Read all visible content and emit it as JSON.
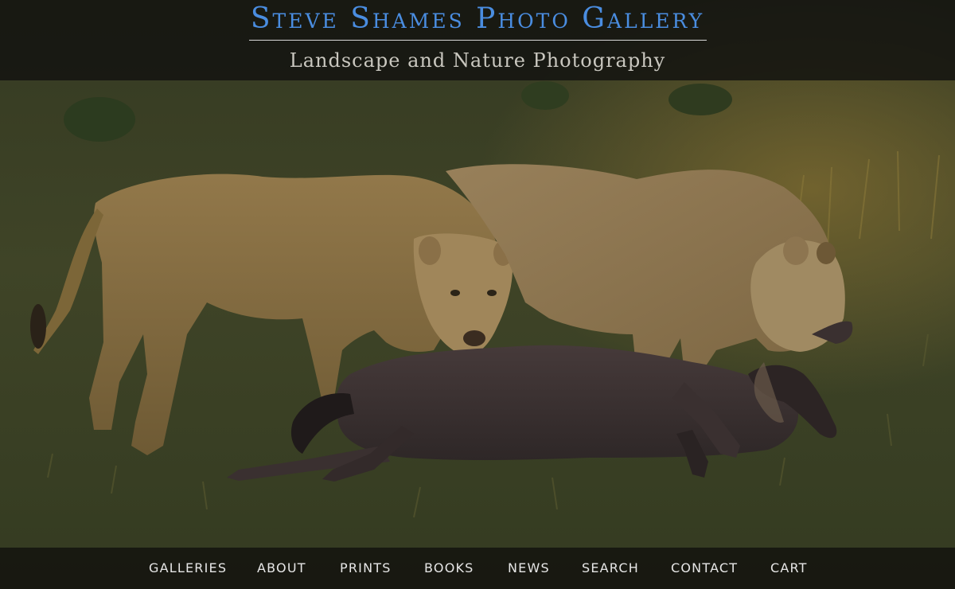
{
  "header": {
    "title": "Steve Shames Photo Gallery",
    "tagline": "Landscape and Nature Photography"
  },
  "nav": {
    "items": [
      {
        "label": "GALLERIES"
      },
      {
        "label": "ABOUT"
      },
      {
        "label": "PRINTS"
      },
      {
        "label": "BOOKS"
      },
      {
        "label": "NEWS"
      },
      {
        "label": "SEARCH"
      },
      {
        "label": "CONTACT"
      },
      {
        "label": "CART"
      }
    ]
  },
  "hero": {
    "subject": "lionesses-with-wildebeest"
  },
  "colors": {
    "title": "#4a8de0",
    "tagline": "#c9c7bf",
    "nav_text": "#e6e6e6",
    "header_bg": "#141410",
    "grass": "#3c4128",
    "lion_fur": "#8a7244",
    "wildebeest": "#3b3232"
  }
}
